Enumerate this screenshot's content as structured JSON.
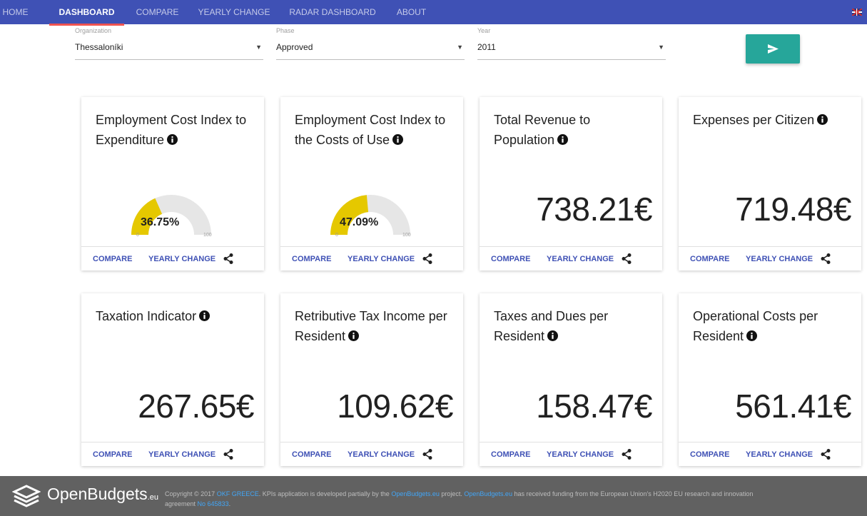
{
  "nav": {
    "items": [
      {
        "label": "HOME",
        "active": false
      },
      {
        "label": "DASHBOARD",
        "active": true
      },
      {
        "label": "COMPARE",
        "active": false
      },
      {
        "label": "YEARLY CHANGE",
        "active": false
      },
      {
        "label": "RADAR DASHBOARD",
        "active": false
      },
      {
        "label": "ABOUT",
        "active": false
      }
    ],
    "language_icon": "uk-flag-icon"
  },
  "filters": {
    "organization": {
      "label": "Organization",
      "value": "Thessaloníki"
    },
    "phase": {
      "label": "Phase",
      "value": "Approved"
    },
    "year": {
      "label": "Year",
      "value": "2011"
    },
    "submit_icon": "send-icon",
    "submit_color": "#26a69a"
  },
  "cards": [
    {
      "title": "Employment Cost Index to Expenditure",
      "type": "gauge",
      "value": "36.75%",
      "fraction": 0.3675,
      "min": "0",
      "max": "100"
    },
    {
      "title": "Employment Cost Index to the Costs of Use",
      "type": "gauge",
      "value": "47.09%",
      "fraction": 0.4709,
      "min": "0",
      "max": "100"
    },
    {
      "title": "Total Revenue to Population",
      "type": "number",
      "value": "738.21€"
    },
    {
      "title": "Expenses per Citizen",
      "type": "number",
      "value": "719.48€"
    },
    {
      "title": "Taxation Indicator",
      "type": "number",
      "value": "267.65€"
    },
    {
      "title": "Retributive Tax Income per Resident",
      "type": "number",
      "value": "109.62€"
    },
    {
      "title": "Taxes and Dues per Resident",
      "type": "number",
      "value": "158.47€"
    },
    {
      "title": "Operational Costs per Resident",
      "type": "number",
      "value": "561.41€"
    }
  ],
  "card_actions": {
    "compare": "COMPARE",
    "yearly_change": "YEARLY CHANGE",
    "share_icon": "share-icon"
  },
  "colors": {
    "primary": "#3f51b5",
    "gauge_fill": "#e5c800",
    "gauge_track": "#e6e6e6",
    "accent_underline": "#ef5350"
  },
  "footer": {
    "logo_main": "OpenBudgets",
    "logo_suffix": ".eu",
    "copyright_prefix": "Copyright © 2017 ",
    "okf_link": "OKF GREECE",
    "text_1": ". KPIs application is developed partially by the ",
    "ob_link_1": "OpenBudgets.eu",
    "text_2": " project. ",
    "ob_link_2": "OpenBudgets.eu",
    "text_3": " has received funding from the European Union's H2020 EU research and innovation",
    "text_4": "agreement ",
    "grant_link": "No 645833",
    "text_5": "."
  }
}
